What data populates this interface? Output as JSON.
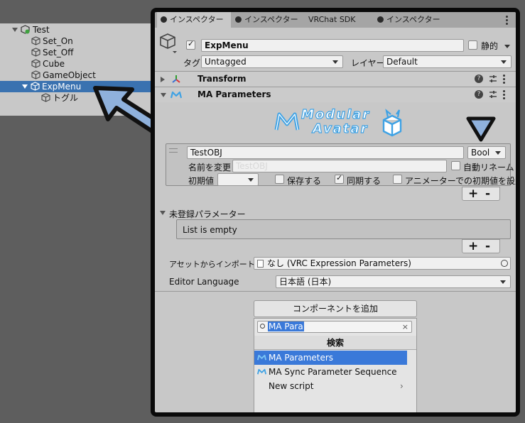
{
  "hierarchy": {
    "items": [
      {
        "label": "Test"
      },
      {
        "label": "Set_On"
      },
      {
        "label": "Set_Off"
      },
      {
        "label": "Cube"
      },
      {
        "label": "GameObject"
      },
      {
        "label": "ExpMenu"
      },
      {
        "label": "トグル"
      }
    ]
  },
  "tabs": [
    {
      "label": "インスペクター"
    },
    {
      "label": "インスペクター"
    },
    {
      "label": "VRChat SDK"
    },
    {
      "label": "インスペクター"
    }
  ],
  "object": {
    "name": "ExpMenu",
    "static_label": "静的",
    "tag_label": "タグ",
    "tag_value": "Untagged",
    "layer_label": "レイヤー",
    "layer_value": "Default"
  },
  "components": {
    "transform": "Transform",
    "ma_parameters": "MA Parameters"
  },
  "logo": {
    "line1": "Modular",
    "line2": "Avatar"
  },
  "parameter": {
    "name": "TestOBJ",
    "type": "Bool",
    "rename_label": "名前を変更",
    "rename_placeholder": "TestOBJ",
    "auto_rename_label": "自動リネーム",
    "initial_label": "初期値",
    "save_label": "保存する",
    "sync_label": "同期する",
    "animator_default_label": "アニメーターでの初期値を設定"
  },
  "unregistered": {
    "label": "未登録パラメーター",
    "empty_text": "List is empty"
  },
  "import": {
    "label": "アセットからインポートする",
    "value": "なし (VRC Expression Parameters)"
  },
  "language": {
    "label": "Editor Language",
    "value": "日本語 (日本)"
  },
  "add_component": {
    "button_label": "コンポーネントを追加",
    "search_value": "MA Para",
    "header": "検索",
    "results": [
      {
        "label": "MA Parameters"
      },
      {
        "label": "MA Sync Parameter Sequence"
      },
      {
        "label": "New script"
      }
    ]
  },
  "colors": {
    "selection": "#3a72b0",
    "popup_selection": "#3a79d9",
    "arrow_fill": "#8fb1dc",
    "ma_icon": "#3fa2e4"
  },
  "icons": [
    "cube-icon",
    "settings-sliders-icon",
    "help-icon",
    "kebab-menu-icon",
    "modular-avatar-icon",
    "search-icon",
    "arrow-pointer-icon"
  ]
}
